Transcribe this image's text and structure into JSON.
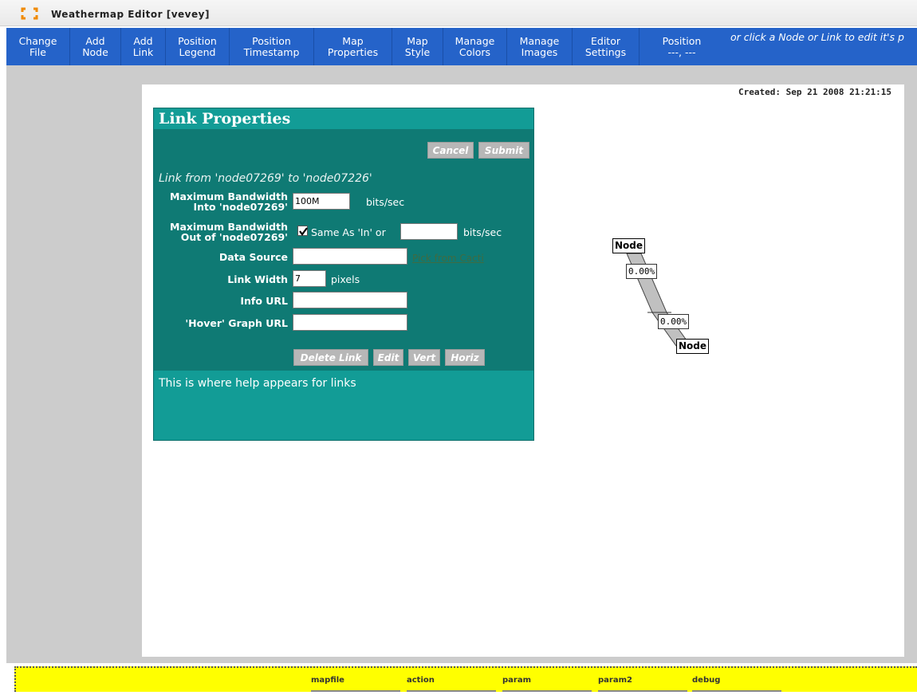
{
  "window": {
    "title": "Weathermap Editor [vevey]",
    "icon": "app-icon"
  },
  "toolbar": {
    "buttons": [
      "Change\nFile",
      "Add\nNode",
      "Add\nLink",
      "Position\nLegend",
      "Position\nTimestamp",
      "Map\nProperties",
      "Map\nStyle",
      "Manage\nColors",
      "Manage\nImages",
      "Editor\nSettings",
      "Position\n---, ---"
    ],
    "hint": "or click a Node or Link to edit it's p"
  },
  "canvas": {
    "created": "Created: Sep 21 2008 21:21:15",
    "nodes": [
      "Node",
      "Node"
    ],
    "labels": [
      "0.00%",
      "0.00%"
    ]
  },
  "dialog": {
    "title": "Link Properties",
    "cancel": "Cancel",
    "submit": "Submit",
    "description": "Link from 'node07269' to 'node07226'",
    "max_bw_in_label_1": "Maximum Bandwidth",
    "max_bw_in_label_2": "Into 'node07269'",
    "max_bw_in_value": "100M",
    "bits_sec": "bits/sec",
    "max_bw_out_label_1": "Maximum Bandwidth",
    "max_bw_out_label_2": "Out of 'node07269'",
    "same_as_in": "Same As 'In' or",
    "max_bw_out_value": "",
    "data_source_label": "Data Source",
    "data_source_value": "",
    "pick_link": "Pick from Cacti",
    "link_width_label": "Link Width",
    "link_width_value": "7",
    "pixels": "pixels",
    "info_url_label": "Info URL",
    "info_url_value": "",
    "hover_url_label": "'Hover' Graph URL",
    "hover_url_value": "",
    "delete_link": "Delete Link",
    "edit": "Edit",
    "vert": "Vert",
    "horiz": "Horiz",
    "help": "This is where help appears for links"
  },
  "debugbar": {
    "items": [
      "mapfile",
      "action",
      "param",
      "param2",
      "debug"
    ]
  },
  "colors": {
    "toolbar": "#2563c9",
    "dialog": "#0f7a74",
    "dialog_header": "#129c96",
    "debugbar": "#ffff00"
  }
}
